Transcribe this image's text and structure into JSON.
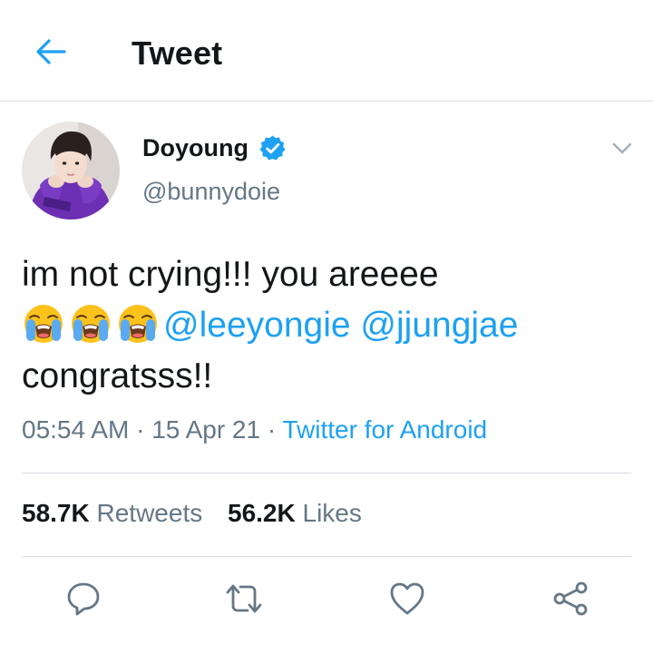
{
  "header": {
    "title": "Tweet",
    "back_icon": "arrow-left-icon",
    "accent": "#1da1f2"
  },
  "author": {
    "display_name": "Doyoung",
    "handle": "@bunnydoie",
    "verified": true,
    "avatar_icon": "avatar"
  },
  "tweet": {
    "line1": "im not crying!!! you areeee",
    "emoji": [
      "loudly-crying-face",
      "loudly-crying-face",
      "loudly-crying-face"
    ],
    "mentions": [
      "@leeyongie",
      "@jjungjae"
    ],
    "line3": "congratsss!!"
  },
  "meta": {
    "time": "05:54 AM",
    "separator": "·",
    "date": "15 Apr 21",
    "source": "Twitter for Android"
  },
  "stats": {
    "retweets_count": "58.7K",
    "retweets_label": "Retweets",
    "likes_count": "56.2K",
    "likes_label": "Likes"
  },
  "actions": [
    "reply-icon",
    "retweet-icon",
    "like-icon",
    "share-icon"
  ],
  "colors": {
    "text": "#14171a",
    "secondary": "#657786",
    "link": "#1da1f2",
    "divider": "#d8dde2"
  }
}
